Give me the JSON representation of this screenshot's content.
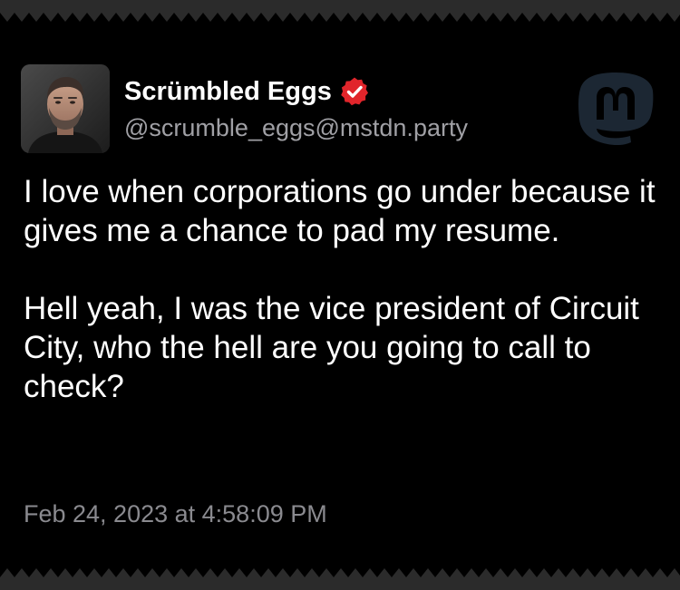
{
  "author": {
    "display_name": "Scrümbled Eggs",
    "handle": "@scrumble_eggs@mstdn.party",
    "verified_icon": "verified-badge-icon",
    "avatar": "avatar-photo"
  },
  "brand": {
    "icon": "mastodon-icon",
    "color": "#1c2733"
  },
  "post": {
    "paragraphs": [
      "I love when corporations go under because it gives me a chance to pad my resume.",
      "Hell yeah, I was the vice president of Circuit City, who the hell are you going to call to check?"
    ],
    "timestamp": "Feb 24, 2023 at 4:58:09 PM"
  },
  "colors": {
    "background": "#000000",
    "text": "#ffffff",
    "secondary_text": "#a0a0a5",
    "verified_red": "#e1252b",
    "edge_gray": "#2b2b2b"
  }
}
